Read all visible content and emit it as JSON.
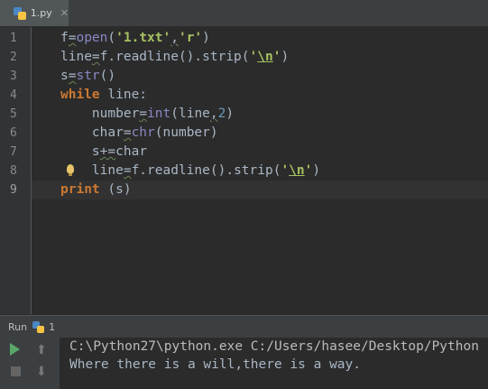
{
  "tab": {
    "label": "1.py",
    "close": "✕",
    "icon": "python-file-icon"
  },
  "gutter": {
    "line_numbers": [
      "1",
      "2",
      "3",
      "4",
      "5",
      "6",
      "7",
      "8",
      "9"
    ],
    "current_line": "9"
  },
  "code": {
    "l1": {
      "a": "f",
      "b": "=",
      "c": "open",
      "d": "(",
      "e": "'1.txt'",
      "f": ",",
      "g": "'r'",
      "h": ")"
    },
    "l2": {
      "a": "line",
      "b": "=",
      "c": "f.readline().strip(",
      "d": "'",
      "e": "\\n",
      "f": "'",
      "g": ")"
    },
    "l3": {
      "a": "s",
      "b": "=",
      "c": "str",
      "d": "()"
    },
    "l4": {
      "a": "while",
      "b": " line:"
    },
    "l5": {
      "a": "    number",
      "b": "=",
      "c": "int",
      "d": "(line",
      "e": ",",
      "f": "2",
      "g": ")"
    },
    "l6": {
      "a": "    char",
      "b": "=",
      "c": "chr",
      "d": "(number)"
    },
    "l7": {
      "a": "    s",
      "b": "+=",
      "c": "char"
    },
    "l8": {
      "a": "    line",
      "b": "=",
      "c": "f.readline().strip(",
      "d": "'",
      "e": "\\n",
      "f": "'",
      "g": ")"
    },
    "l9": {
      "a": "print",
      "b": " (s)"
    }
  },
  "run_panel": {
    "label": "Run",
    "config": "1",
    "command": "C:\\Python27\\python.exe C:/Users/hasee/Desktop/Python",
    "output": "Where there is a will,there is a way."
  },
  "colors": {
    "keyword": "#cc7832",
    "string": "#a5c261",
    "number": "#6897bb",
    "builtin": "#8888c6",
    "text": "#a9b7c6"
  }
}
